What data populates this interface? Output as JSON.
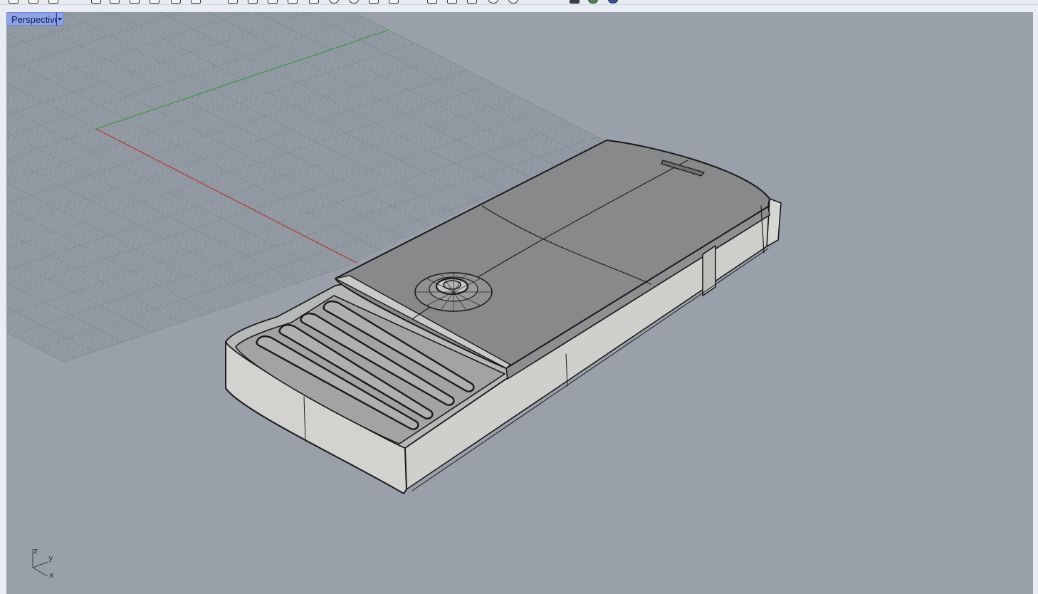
{
  "viewport": {
    "title": "Perspective",
    "background": "#99a0a9",
    "tab_color": "#8fa3e8"
  },
  "toolbar": {
    "icons": [
      "new-icon",
      "open-icon",
      "save-icon",
      "print-icon",
      "cut-icon",
      "copy-icon",
      "paste-icon",
      "undo-icon",
      "redo-icon",
      "pan-icon",
      "rotate-icon",
      "zoom-icon",
      "zoom-extents-icon",
      "zoom-window-icon",
      "zoom-selected-icon",
      "viewport-icon",
      "grid-icon",
      "snap-icon",
      "layer-icon",
      "properties-icon",
      "render-icon",
      "material-icon",
      "sphere-icon",
      "shade-icon",
      "help-icon"
    ]
  },
  "grid": {
    "x_axis_color": "#b23a3a",
    "y_axis_color": "#3b9a3b",
    "line_color": "#7b8591"
  },
  "axis_triad": {
    "z_label": "z",
    "y_label": "y",
    "x_label": "x"
  },
  "model": {
    "name": "mobile-phone-slider",
    "top_color": "#8a8b8d",
    "side_color": "#c9c9c6",
    "keypad_color": "#a6a7a6"
  }
}
